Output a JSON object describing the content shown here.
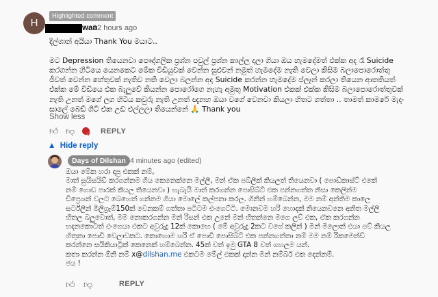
{
  "comment": {
    "avatar_letter": "H",
    "badge": "Highlighted comment",
    "author_tail": "wan",
    "time": "12 hours ago",
    "text": "දිල්ශාන් අයියා Thank You මයාට..\n\nමට Depression තියෙනවා පෞද්ගලික ප්‍රශ්න පවුල් ප්‍රශ්න කාල්ල දාලා ගියා ඔය හැමදේමත් එක්ක අද රෑ Suicide\nකරගන්න හිටියෙ යෙනකෙට මේක විඩියුවක් වෙන්න සුළුවන් නමුත් හැමදේම නැති වෙලා කිසිම බලාපොරොත්තු\nජීවත් වෙන්න හේතුවක් නැතිව නති වෙලා බලන්න අද Suicide කරන්න හැමදේම ප්ලෑන් කරලා තියෙන ආතතියත්\nඑක්ක මේ විඩියෙ එක බැලුවේ කියන්න පොරෝගෙ නැහැ අමුතු Motivation එකක් එක්ක කිසිම බලාපොරොත්තුවක්\nනැති උනත් මගේ ලග හිටිය කවුරු නැති උනත් ඥැනහ ඔයා වගේ වෙනවා කියලා හිතට ගත්තා .. තාමත් කාමරේ මැදං\nසාලේ බෙඩ් ශීට් එක උඩ එල්ලලා තියෙන්නේ 🙏 Thank you",
    "show_less": "Show less",
    "reply_label": "REPLY"
  },
  "hide_reply": "Hide reply",
  "reply": {
    "author": "Days of Dilshan",
    "time": "4 minutes ago (edited)",
    "text_before_link": "ඔයා මේක හරා දාපු එකක් නම්,\nමාත් සුයිසයිඩ් කරගන්නම ගිය කෙනෙක්නෙ මල්ලී, මන් ඒක පබ්ලික් කියලත් තියෙනවා ( පොඩ්කාස්ට් එකේ\nනම් ගොඩ පාරක් කියල තියෙනවා ) හැබැයි මාත් කරගන්න පොසිබ්ට් එක පන්නගත්ත නිසා කෙලින්ම\nඩිප්‍රෙශන් වලට බෙහෙත් ගන්නම ගියා මොලේ කල්පනා කරල. ගිනින් හම්බෙන්න, මම නම් අන්තිම කාලෙ\nසර්ට්ලින් මිලිග්‍රෑම්150ක් වෙනකම් ගත්තා පටිටම එංගෙට්ටි. මොනවම හරි හොදක් නියෙනවනෙ අනිත මල්ලි\nහිතල බලුවොත්, මම නොකරගන්න මන් රිසන් එක උනේ මන් හිතන්නෙ මගෙ ලව් එක, ඒක කරගන්න\nහදනකොටත් එංගෙයා එකට අවුරුදු 12ක් කොහෙ ( මේ අවුරුදු 2කට වගේ කලින් ) මන් මලොන් එයා පව් කියල\nහිතුනා පොඩි වෙලාවකට. කොහොම හරි ඒ පොඩි පොසිබ්ට් එක පන්නගත්තා නම් මම නම් රිකමෙන්ඩ්\nකරන්නෙ සයිකියාට්‍රික් කෙනෙක් හම්බෙන්න. 45ක් වත් ඉමු GTA 8 වත් ගහලම යන්.\nකතා කරන්න ඕනි නම් x@",
    "link": "dilshan.me",
    "text_after_link": " එකටම මේල් එකක් දාන්න මන් නම්බර් එක දෙන්නම්.\nජය !",
    "reply_label": "REPLY"
  },
  "icons": {
    "like": "thumbs-up-icon",
    "dislike": "thumbs-down-icon",
    "creator_heart": "creator-heart-icon",
    "collapse": "chevron-up-icon"
  },
  "colors": {
    "link": "#065fd4",
    "owner_chip": "#888888",
    "heart": "#e53935"
  }
}
